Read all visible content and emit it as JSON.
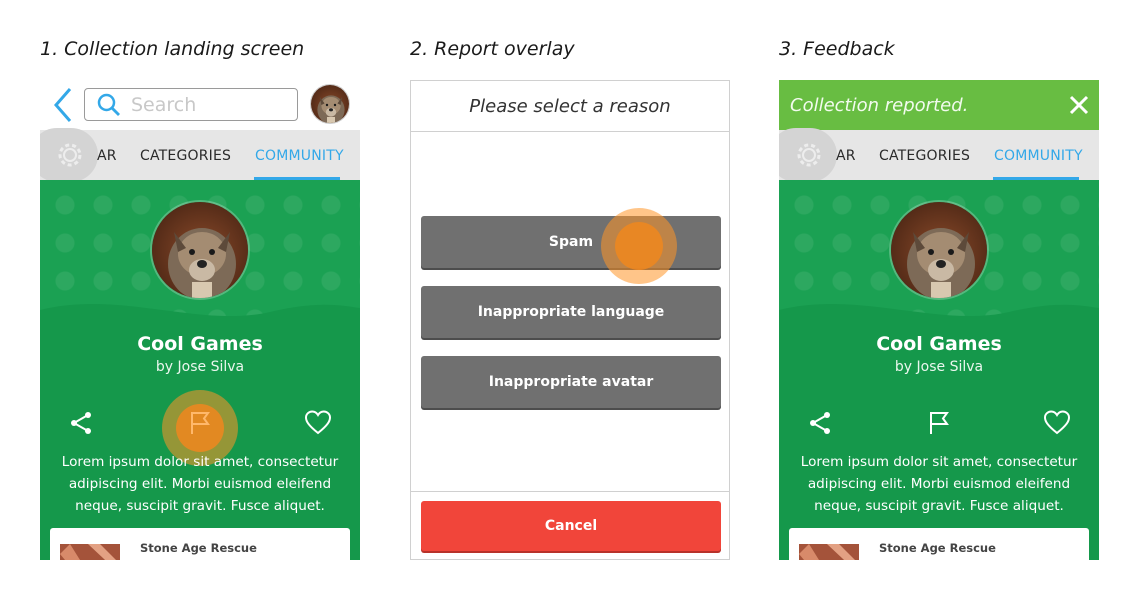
{
  "captions": [
    "1. Collection landing screen",
    "2. Report overlay",
    "3. Feedback"
  ],
  "search": {
    "placeholder": "Search"
  },
  "tabs": {
    "partial": "AR",
    "categories": "CATEGORIES",
    "community": "COMMUNITY"
  },
  "collection": {
    "title": "Cool Games",
    "author": "by Jose Silva",
    "description": "Lorem ipsum dolor sit amet, consectetur adipiscing elit. Morbi euismod eleifend neque, suscipit gravit. Fusce aliquet.",
    "card_title": "Stone Age Rescue"
  },
  "overlay": {
    "heading": "Please select a reason",
    "reasons": [
      "Spam",
      "Inappropriate language",
      "Inappropriate avatar"
    ],
    "cancel": "Cancel"
  },
  "feedback": {
    "message": "Collection reported."
  },
  "colors": {
    "green": "#1ba153",
    "accent_blue": "#33a8e8",
    "notice_green": "#68bd42",
    "cancel_red": "#f1453a",
    "reason_gray": "#707070",
    "touch_orange": "#f0871e"
  },
  "icons": [
    "back-arrow-icon",
    "search-icon",
    "gear-icon",
    "share-icon",
    "flag-icon",
    "heart-icon",
    "close-icon"
  ]
}
